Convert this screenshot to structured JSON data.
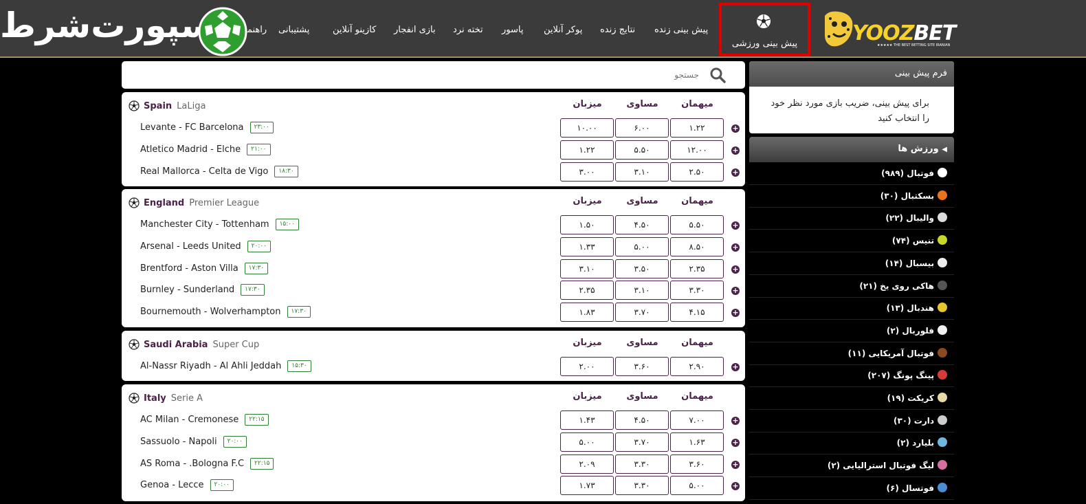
{
  "nav": {
    "items": [
      "پیش بینی زنده",
      "نتایج زنده",
      "پوکر آنلاین",
      "پاسور",
      "تخته نرد",
      "بازی انفجار",
      "کازینو آنلاین",
      "پشتیبانی",
      "راهنما"
    ],
    "active_label": "پیش بینی ورزشی",
    "logo_word_left": "YOOZ",
    "logo_word_right": "BET",
    "logo_sub": "★★★★★ THE BEST BETTING SITE IRANIAN",
    "esport_logo": "اسپورت‌شرط"
  },
  "search": {
    "placeholder": "جستجو"
  },
  "columns": {
    "away": "میهمان",
    "draw": "مساوی",
    "home": "میزبان"
  },
  "leagues": [
    {
      "country": "Spain",
      "competition": "LaLiga",
      "matches": [
        {
          "teams": "Levante  -  FC Barcelona",
          "time": "۲۳:۰۰",
          "home": "۱۰.۰۰",
          "draw": "۶.۰۰",
          "away": "۱.۲۲"
        },
        {
          "teams": "Atletico Madrid  -  Elche",
          "time": "۲۱:۰۰",
          "home": "۱.۲۲",
          "draw": "۵.۵۰",
          "away": "۱۲.۰۰"
        },
        {
          "teams": "Real Mallorca  -  Celta de Vigo",
          "time": "۱۸:۳۰",
          "home": "۳.۰۰",
          "draw": "۳.۱۰",
          "away": "۲.۵۰"
        }
      ]
    },
    {
      "country": "England",
      "competition": "Premier League",
      "matches": [
        {
          "teams": "Manchester City  -  Tottenham",
          "time": "۱۵:۰۰",
          "home": "۱.۵۰",
          "draw": "۴.۵۰",
          "away": "۵.۵۰"
        },
        {
          "teams": "Arsenal  -  Leeds United",
          "time": "۲۰:۰۰",
          "home": "۱.۳۳",
          "draw": "۵.۰۰",
          "away": "۸.۵۰"
        },
        {
          "teams": "Brentford  -  Aston Villa",
          "time": "۱۷:۳۰",
          "home": "۳.۱۰",
          "draw": "۳.۵۰",
          "away": "۲.۳۵"
        },
        {
          "teams": "Burnley  -  Sunderland",
          "time": "۱۷:۳۰",
          "home": "۲.۳۵",
          "draw": "۳.۱۰",
          "away": "۳.۳۰"
        },
        {
          "teams": "Bournemouth  -  Wolverhampton",
          "time": "۱۷:۳۰",
          "home": "۱.۸۳",
          "draw": "۳.۷۰",
          "away": "۴.۱۵"
        }
      ]
    },
    {
      "country": "Saudi Arabia",
      "competition": "Super Cup",
      "matches": [
        {
          "teams": "Al-Nassr Riyadh  -  Al Ahli Jeddah",
          "time": "۱۵:۳۰",
          "home": "۲.۰۰",
          "draw": "۳.۶۰",
          "away": "۲.۹۰"
        }
      ]
    },
    {
      "country": "Italy",
      "competition": "Serie A",
      "matches": [
        {
          "teams": "AC Milan  -  Cremonese",
          "time": "۲۲:۱۵",
          "home": "۱.۴۳",
          "draw": "۴.۵۰",
          "away": "۷.۰۰"
        },
        {
          "teams": "Sassuolo  -  Napoli",
          "time": "۲۰:۰۰",
          "home": "۵.۰۰",
          "draw": "۳.۷۰",
          "away": "۱.۶۳"
        },
        {
          "teams": "AS Roma  -  .Bologna F.C",
          "time": "۲۲:۱۵",
          "home": "۲.۰۹",
          "draw": "۳.۳۰",
          "away": "۳.۶۰"
        },
        {
          "teams": "Genoa  -  Lecce",
          "time": "۲۰:۰۰",
          "home": "۱.۷۳",
          "draw": "۳.۳۰",
          "away": "۵.۰۰"
        }
      ]
    }
  ],
  "form": {
    "title": "فرم پیش بینی",
    "text": "برای پیش بینی، ضریب بازی مورد نظر خود را انتخاب کنید"
  },
  "sports": {
    "title": "ورزش ها",
    "items": [
      {
        "label": "فوتبال (۹۸۹)",
        "color": "#ffffff",
        "icon": "soccer-icon"
      },
      {
        "label": "بسکتبال (۳۰)",
        "color": "#e8731c",
        "icon": "basketball-icon"
      },
      {
        "label": "والیبال (۲۲)",
        "color": "#dddddd",
        "icon": "volleyball-icon"
      },
      {
        "label": "تنیس (۷۴)",
        "color": "#c8d62a",
        "icon": "tennis-icon"
      },
      {
        "label": "بیسبال (۱۴)",
        "color": "#eeeeee",
        "icon": "baseball-icon"
      },
      {
        "label": "هاکی روی یخ (۲۱)",
        "color": "#555555",
        "icon": "ice-hockey-icon"
      },
      {
        "label": "هندبال (۱۳)",
        "color": "#e8c72a",
        "icon": "handball-icon"
      },
      {
        "label": "فلوربال (۲)",
        "color": "#f0f0f0",
        "icon": "floorball-icon"
      },
      {
        "label": "فوتبال آمریکایی (۱۱)",
        "color": "#8b4a22",
        "icon": "american-football-icon"
      },
      {
        "label": "پینگ پونگ (۲۰۷)",
        "color": "#d83a3a",
        "icon": "table-tennis-icon"
      },
      {
        "label": "کریکت (۱۹)",
        "color": "#e8d9a8",
        "icon": "cricket-icon"
      },
      {
        "label": "دارت (۳۰)",
        "color": "#cccccc",
        "icon": "darts-icon"
      },
      {
        "label": "بلیارد (۲)",
        "color": "#6fb6e0",
        "icon": "billiards-icon"
      },
      {
        "label": "لیگ فوتبال استرالیایی (۲)",
        "color": "#d46fa0",
        "icon": "aussie-rules-icon"
      },
      {
        "label": "فوتسال (۶)",
        "color": "#4a8fd4",
        "icon": "futsal-icon"
      }
    ]
  }
}
